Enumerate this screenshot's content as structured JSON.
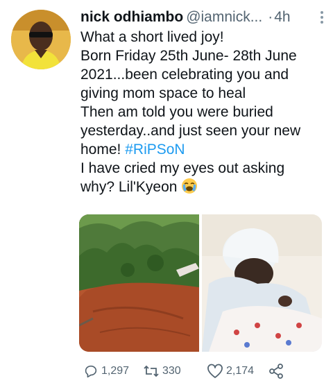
{
  "author": {
    "name": "nick odhiambo",
    "handle": "@iamnick...",
    "separator": "·",
    "time": "4h"
  },
  "tweet": {
    "lines": [
      "What a short lived joy!",
      "Born Friday 25th June- 28th June",
      "2021...been celebrating you and",
      "giving mom space to heal",
      "Then am told you were buried",
      "yesterday..and just seen your new",
      "home!"
    ],
    "hashtag": "#RiPSoN",
    "lines_after": [
      "I have cried my eyes out asking"
    ],
    "last_line": "why? Lil'Kyeon",
    "emoji": "crying-face"
  },
  "actions": {
    "replies": "1,297",
    "retweets": "330",
    "likes": "2,174"
  },
  "colors": {
    "hashtag": "#1d9bf0",
    "muted": "#536471"
  },
  "icons": [
    "more-vertical-icon",
    "reply-icon",
    "retweet-icon",
    "like-icon",
    "share-icon",
    "crying-emoji-icon"
  ]
}
